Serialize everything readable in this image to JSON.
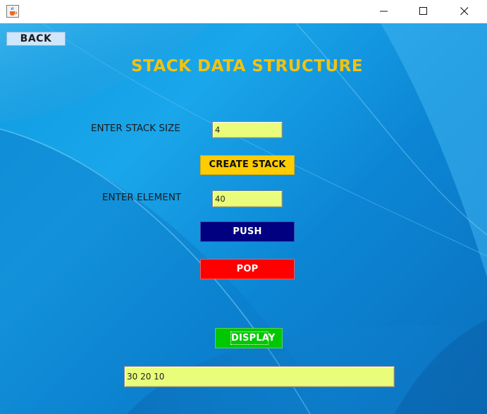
{
  "window": {
    "icons": {
      "app": "java-cup-icon",
      "minimize": "minimize-icon",
      "maximize": "maximize-icon",
      "close": "close-icon"
    }
  },
  "header": {
    "back_label": "BACK",
    "title": "STACK DATA STRUCTURE"
  },
  "form": {
    "stack_size_label": "ENTER STACK SIZE",
    "stack_size_value": "4",
    "create_label": "CREATE STACK",
    "element_label": "ENTER ELEMENT",
    "element_value": "40",
    "push_label": "PUSH",
    "pop_label": "POP",
    "display_label": "DISPLAY",
    "output_value": "30 20 10"
  },
  "colors": {
    "title": "#f4c20d",
    "field_bg": "#e9fd7b",
    "create_btn": "#ffcc00",
    "push_btn": "#000080",
    "pop_btn": "#ff0000",
    "display_btn": "#00c800",
    "back_btn": "#cfe6fb"
  }
}
